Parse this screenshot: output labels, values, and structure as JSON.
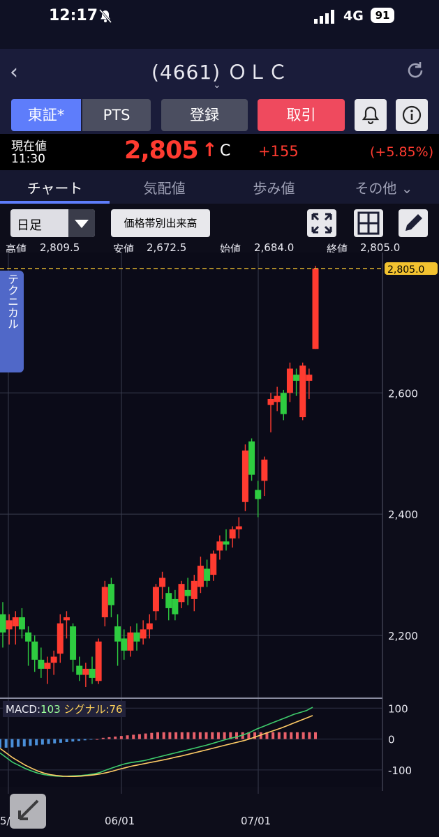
{
  "status": {
    "time": "12:17",
    "network": "4G",
    "battery": "91"
  },
  "header": {
    "title": "(4661) ＯＬＣ"
  },
  "market_buttons": {
    "tosho": "東証*",
    "pts": "PTS",
    "register": "登録",
    "trade": "取引"
  },
  "price_row": {
    "label_now": "現在値",
    "time": "11:30",
    "price": "2,805",
    "arrow": "↑",
    "flag": "C",
    "change": "+155",
    "change_pct": "(+5.85%)"
  },
  "tabs": [
    "チャート",
    "気配値",
    "歩み値",
    "その他 ⌄"
  ],
  "toolbar": {
    "period": "日足",
    "volume_button": "価格帯別出来高"
  },
  "ohlc": {
    "high_label": "高値",
    "high": "2,809.5",
    "low_label": "安値",
    "low": "2,672.5",
    "open_label": "始値",
    "open": "2,684.0",
    "close_label": "終値",
    "close": "2,805.0"
  },
  "side_tab": "テクニカル",
  "macd": {
    "label": "MACD:",
    "macd": "103",
    "signal_label": "シグナル:",
    "signal": "76"
  },
  "colors": {
    "up": "#ff3b30",
    "down": "#2ecc40",
    "accent": "#5e7dfb",
    "macd_line": "#3ecc6c",
    "signal_line": "#ffcc66"
  },
  "chart_data": {
    "type": "candlestick",
    "price_axis": {
      "ticks": [
        2200,
        2400,
        2600
      ],
      "last_price_label": "2,805.0",
      "ylim": [
        2100,
        2820
      ]
    },
    "macd_axis": {
      "ticks": [
        "100",
        "0",
        "-100"
      ],
      "ylim": [
        -150,
        130
      ]
    },
    "x_ticks": [
      "5/",
      "06/01",
      "07/01"
    ],
    "candles": [
      [
        2235,
        2255,
        2180,
        2205
      ],
      [
        2210,
        2235,
        2185,
        2225
      ],
      [
        2215,
        2240,
        2185,
        2230
      ],
      [
        2230,
        2245,
        2195,
        2210
      ],
      [
        2205,
        2215,
        2150,
        2190
      ],
      [
        2190,
        2200,
        2140,
        2160
      ],
      [
        2160,
        2180,
        2130,
        2145
      ],
      [
        2145,
        2165,
        2120,
        2155
      ],
      [
        2155,
        2175,
        2135,
        2165
      ],
      [
        2170,
        2235,
        2155,
        2220
      ],
      [
        2225,
        2240,
        2195,
        2230
      ],
      [
        2215,
        2220,
        2140,
        2160
      ],
      [
        2150,
        2165,
        2125,
        2135
      ],
      [
        2135,
        2155,
        2115,
        2145
      ],
      [
        2145,
        2165,
        2120,
        2130
      ],
      [
        2125,
        2195,
        2120,
        2190
      ],
      [
        2230,
        2290,
        2215,
        2280
      ],
      [
        2285,
        2295,
        2230,
        2250
      ],
      [
        2215,
        2235,
        2150,
        2190
      ],
      [
        2195,
        2210,
        2160,
        2175
      ],
      [
        2175,
        2215,
        2165,
        2205
      ],
      [
        2205,
        2220,
        2175,
        2190
      ],
      [
        2195,
        2225,
        2185,
        2210
      ],
      [
        2210,
        2235,
        2195,
        2220
      ],
      [
        2240,
        2285,
        2225,
        2280
      ],
      [
        2280,
        2305,
        2260,
        2295
      ],
      [
        2270,
        2280,
        2225,
        2245
      ],
      [
        2260,
        2275,
        2225,
        2235
      ],
      [
        2255,
        2290,
        2245,
        2285
      ],
      [
        2275,
        2295,
        2250,
        2265
      ],
      [
        2260,
        2300,
        2240,
        2290
      ],
      [
        2280,
        2330,
        2270,
        2315
      ],
      [
        2310,
        2325,
        2280,
        2290
      ],
      [
        2300,
        2340,
        2290,
        2335
      ],
      [
        2340,
        2365,
        2325,
        2355
      ],
      [
        2355,
        2375,
        2340,
        2350
      ],
      [
        2360,
        2380,
        2345,
        2375
      ],
      [
        2375,
        2395,
        2360,
        2380
      ],
      [
        2420,
        2515,
        2405,
        2505
      ],
      [
        2520,
        2525,
        2455,
        2465
      ],
      [
        2440,
        2455,
        2395,
        2425
      ],
      [
        2455,
        2495,
        2430,
        2490
      ],
      [
        2580,
        2600,
        2535,
        2590
      ],
      [
        2585,
        2610,
        2570,
        2595
      ],
      [
        2600,
        2605,
        2555,
        2565
      ],
      [
        2600,
        2650,
        2585,
        2640
      ],
      [
        2630,
        2640,
        2595,
        2620
      ],
      [
        2560,
        2650,
        2555,
        2645
      ],
      [
        2620,
        2640,
        2590,
        2630
      ],
      [
        2672.5,
        2809.5,
        2672.5,
        2805
      ]
    ],
    "macd_hist": [
      -28,
      -28,
      -27,
      -25,
      -24,
      -22,
      -20,
      -18,
      -16,
      -14,
      -12,
      -10,
      -8,
      -6,
      -4,
      -2,
      0,
      4,
      6,
      8,
      10,
      12,
      14,
      16,
      18,
      20,
      22,
      22,
      22,
      22,
      22,
      22,
      22,
      22,
      22,
      22,
      22,
      22,
      22,
      22,
      22,
      22,
      22,
      22,
      22,
      22,
      22,
      22,
      22,
      22,
      22,
      22,
      22
    ],
    "series": [
      {
        "name": "MACD",
        "values": [
          -45,
          -60,
          -75,
          -85,
          -95,
          -103,
          -110,
          -115,
          -118,
          -120,
          -121,
          -120,
          -119,
          -118,
          -116,
          -113,
          -108,
          -100,
          -93,
          -86,
          -80,
          -76,
          -73,
          -70,
          -65,
          -60,
          -55,
          -50,
          -45,
          -40,
          -35,
          -30,
          -25,
          -20,
          -14,
          -8,
          -2,
          3,
          8,
          14,
          22,
          32,
          40,
          48,
          56,
          64,
          72,
          80,
          86,
          92,
          103
        ]
      },
      {
        "name": "シグナル",
        "values": [
          -30,
          -45,
          -60,
          -72,
          -84,
          -94,
          -103,
          -110,
          -115,
          -118,
          -120,
          -121,
          -121,
          -120,
          -118,
          -116,
          -113,
          -109,
          -104,
          -98,
          -93,
          -88,
          -84,
          -80,
          -76,
          -72,
          -68,
          -64,
          -59,
          -55,
          -50,
          -45,
          -40,
          -35,
          -30,
          -25,
          -20,
          -15,
          -10,
          -5,
          1,
          8,
          15,
          22,
          29,
          36,
          44,
          52,
          60,
          68,
          76
        ]
      }
    ]
  }
}
